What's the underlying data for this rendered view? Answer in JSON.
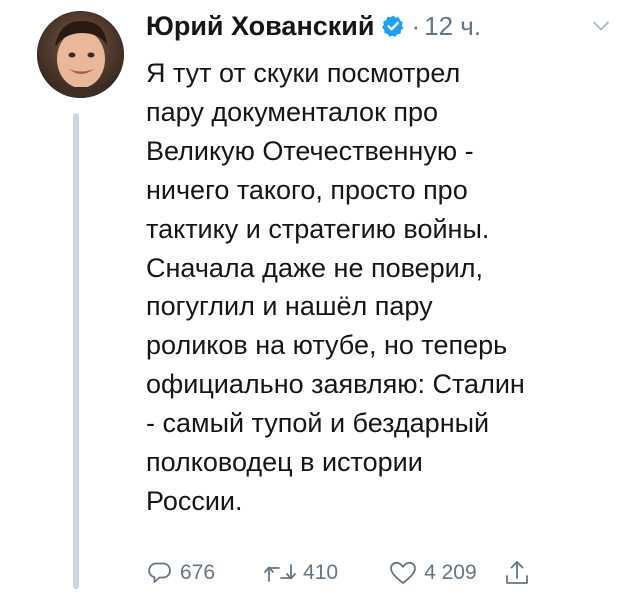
{
  "tweet": {
    "author_name": "Юрий Хованский",
    "time_separator": "·",
    "time_ago": "12 ч.",
    "lines": [
      "Я тут от скуки посмотрел",
      "пару документалок про",
      "Великую Отечественную -",
      "ничего такого, просто про",
      "тактику и стратегию войны.",
      "Сначала даже не поверил,",
      "погуглил и нашёл пару",
      "роликов на ютубе, но теперь",
      "официально заявляю: Сталин",
      "- самый тупой и бездарный",
      "полководец в истории",
      "России."
    ],
    "replies": "676",
    "retweets": "410",
    "likes": "4 209"
  },
  "icons": {
    "verified": "verified-badge-icon",
    "caret": "chevron-down-icon",
    "reply": "reply-icon",
    "retweet": "retweet-icon",
    "like": "heart-icon",
    "share": "share-icon"
  },
  "colors": {
    "verified_blue": "#1da1f2",
    "muted_text": "#657786",
    "thread_line": "#ccd6dd"
  }
}
